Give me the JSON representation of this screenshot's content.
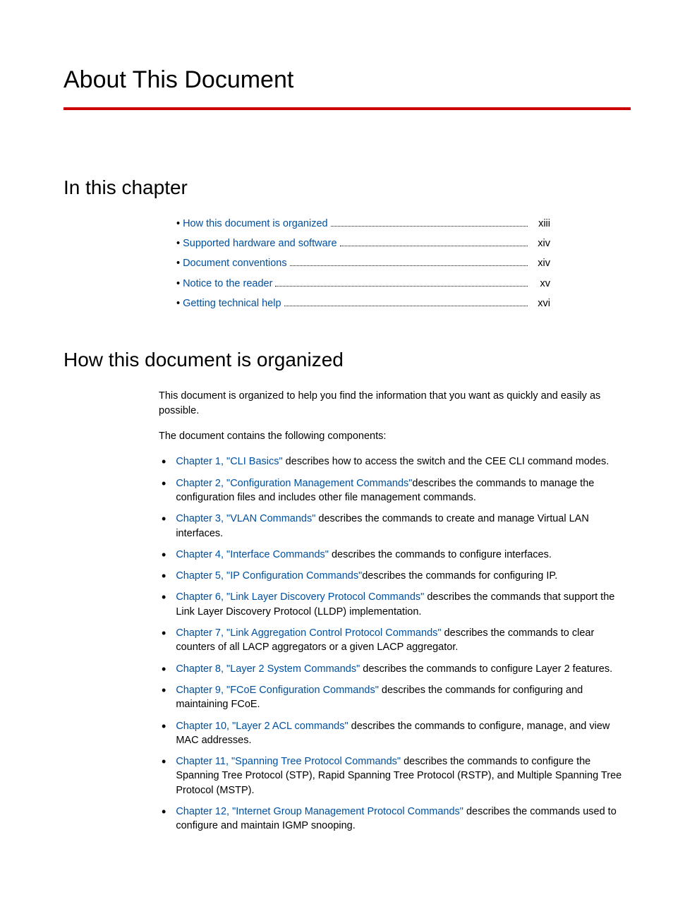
{
  "title": "About This Document",
  "sections": {
    "in_this_chapter": "In this chapter",
    "how_organized": "How this document is organized"
  },
  "toc": [
    {
      "label": "How this document is organized",
      "page": "xiii"
    },
    {
      "label": "Supported hardware and software",
      "page": "xiv"
    },
    {
      "label": "Document conventions",
      "page": "xiv"
    },
    {
      "label": "Notice to the reader",
      "page": "xv"
    },
    {
      "label": "Getting technical help",
      "page": "xvi"
    }
  ],
  "intro": {
    "p1": "This document is organized to help you find the information that you want as quickly and easily as possible.",
    "p2": "The document contains the following components:"
  },
  "chapters": [
    {
      "link": "Chapter 1, \"CLI Basics\"",
      "desc": " describes how to access the switch and the CEE CLI command modes."
    },
    {
      "link": "Chapter 2, \"Configuration Management Commands\"",
      "desc": "describes the commands to manage the configuration files and includes other file management commands."
    },
    {
      "link": "Chapter 3, \"VLAN Commands\"",
      "desc": " describes the commands to create and manage Virtual LAN interfaces."
    },
    {
      "link": "Chapter 4, \"Interface Commands\"",
      "desc": " describes the commands to configure interfaces."
    },
    {
      "link": "Chapter 5, \"IP Configuration Commands\"",
      "desc": "describes the commands for configuring IP."
    },
    {
      "link": "Chapter 6, \"Link Layer Discovery Protocol Commands\"",
      "desc": " describes the commands that support the Link Layer Discovery Protocol (LLDP) implementation."
    },
    {
      "link": "Chapter 7, \"Link Aggregation Control Protocol Commands\"",
      "desc": " describes the commands to clear counters of all LACP aggregators or a given LACP aggregator."
    },
    {
      "link": "Chapter 8, \"Layer 2 System Commands\"",
      "desc": " describes the commands to configure Layer 2 features."
    },
    {
      "link": "Chapter 9, \"FCoE Configuration Commands\"",
      "desc": " describes the commands for configuring and maintaining FCoE."
    },
    {
      "link": "Chapter 10, \"Layer 2 ACL commands\"",
      "desc": " describes the commands to configure, manage, and view MAC addresses."
    },
    {
      "link": "Chapter 11, \"Spanning Tree Protocol Commands\"",
      "desc": " describes the commands to configure the Spanning Tree Protocol (STP), Rapid Spanning Tree Protocol (RSTP), and Multiple Spanning Tree Protocol (MSTP)."
    },
    {
      "link": "Chapter 12, \"Internet Group Management Protocol Commands\"",
      "desc": " describes the commands used to configure and maintain IGMP snooping."
    }
  ]
}
